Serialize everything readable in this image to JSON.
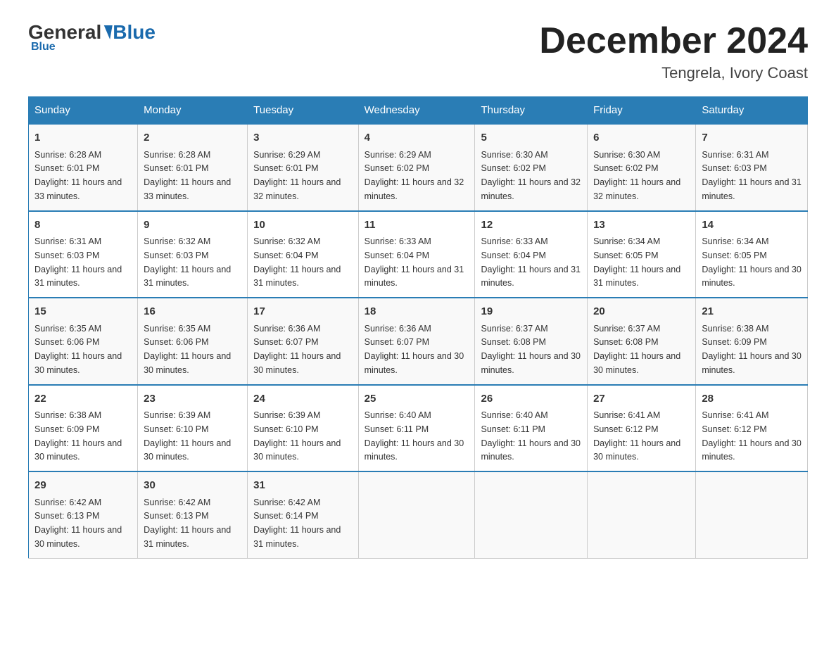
{
  "header": {
    "logo_general": "General",
    "logo_blue": "Blue",
    "month_title": "December 2024",
    "location": "Tengrela, Ivory Coast"
  },
  "days_of_week": [
    "Sunday",
    "Monday",
    "Tuesday",
    "Wednesday",
    "Thursday",
    "Friday",
    "Saturday"
  ],
  "weeks": [
    [
      {
        "day": "1",
        "sunrise": "6:28 AM",
        "sunset": "6:01 PM",
        "daylight": "11 hours and 33 minutes."
      },
      {
        "day": "2",
        "sunrise": "6:28 AM",
        "sunset": "6:01 PM",
        "daylight": "11 hours and 33 minutes."
      },
      {
        "day": "3",
        "sunrise": "6:29 AM",
        "sunset": "6:01 PM",
        "daylight": "11 hours and 32 minutes."
      },
      {
        "day": "4",
        "sunrise": "6:29 AM",
        "sunset": "6:02 PM",
        "daylight": "11 hours and 32 minutes."
      },
      {
        "day": "5",
        "sunrise": "6:30 AM",
        "sunset": "6:02 PM",
        "daylight": "11 hours and 32 minutes."
      },
      {
        "day": "6",
        "sunrise": "6:30 AM",
        "sunset": "6:02 PM",
        "daylight": "11 hours and 32 minutes."
      },
      {
        "day": "7",
        "sunrise": "6:31 AM",
        "sunset": "6:03 PM",
        "daylight": "11 hours and 31 minutes."
      }
    ],
    [
      {
        "day": "8",
        "sunrise": "6:31 AM",
        "sunset": "6:03 PM",
        "daylight": "11 hours and 31 minutes."
      },
      {
        "day": "9",
        "sunrise": "6:32 AM",
        "sunset": "6:03 PM",
        "daylight": "11 hours and 31 minutes."
      },
      {
        "day": "10",
        "sunrise": "6:32 AM",
        "sunset": "6:04 PM",
        "daylight": "11 hours and 31 minutes."
      },
      {
        "day": "11",
        "sunrise": "6:33 AM",
        "sunset": "6:04 PM",
        "daylight": "11 hours and 31 minutes."
      },
      {
        "day": "12",
        "sunrise": "6:33 AM",
        "sunset": "6:04 PM",
        "daylight": "11 hours and 31 minutes."
      },
      {
        "day": "13",
        "sunrise": "6:34 AM",
        "sunset": "6:05 PM",
        "daylight": "11 hours and 31 minutes."
      },
      {
        "day": "14",
        "sunrise": "6:34 AM",
        "sunset": "6:05 PM",
        "daylight": "11 hours and 30 minutes."
      }
    ],
    [
      {
        "day": "15",
        "sunrise": "6:35 AM",
        "sunset": "6:06 PM",
        "daylight": "11 hours and 30 minutes."
      },
      {
        "day": "16",
        "sunrise": "6:35 AM",
        "sunset": "6:06 PM",
        "daylight": "11 hours and 30 minutes."
      },
      {
        "day": "17",
        "sunrise": "6:36 AM",
        "sunset": "6:07 PM",
        "daylight": "11 hours and 30 minutes."
      },
      {
        "day": "18",
        "sunrise": "6:36 AM",
        "sunset": "6:07 PM",
        "daylight": "11 hours and 30 minutes."
      },
      {
        "day": "19",
        "sunrise": "6:37 AM",
        "sunset": "6:08 PM",
        "daylight": "11 hours and 30 minutes."
      },
      {
        "day": "20",
        "sunrise": "6:37 AM",
        "sunset": "6:08 PM",
        "daylight": "11 hours and 30 minutes."
      },
      {
        "day": "21",
        "sunrise": "6:38 AM",
        "sunset": "6:09 PM",
        "daylight": "11 hours and 30 minutes."
      }
    ],
    [
      {
        "day": "22",
        "sunrise": "6:38 AM",
        "sunset": "6:09 PM",
        "daylight": "11 hours and 30 minutes."
      },
      {
        "day": "23",
        "sunrise": "6:39 AM",
        "sunset": "6:10 PM",
        "daylight": "11 hours and 30 minutes."
      },
      {
        "day": "24",
        "sunrise": "6:39 AM",
        "sunset": "6:10 PM",
        "daylight": "11 hours and 30 minutes."
      },
      {
        "day": "25",
        "sunrise": "6:40 AM",
        "sunset": "6:11 PM",
        "daylight": "11 hours and 30 minutes."
      },
      {
        "day": "26",
        "sunrise": "6:40 AM",
        "sunset": "6:11 PM",
        "daylight": "11 hours and 30 minutes."
      },
      {
        "day": "27",
        "sunrise": "6:41 AM",
        "sunset": "6:12 PM",
        "daylight": "11 hours and 30 minutes."
      },
      {
        "day": "28",
        "sunrise": "6:41 AM",
        "sunset": "6:12 PM",
        "daylight": "11 hours and 30 minutes."
      }
    ],
    [
      {
        "day": "29",
        "sunrise": "6:42 AM",
        "sunset": "6:13 PM",
        "daylight": "11 hours and 30 minutes."
      },
      {
        "day": "30",
        "sunrise": "6:42 AM",
        "sunset": "6:13 PM",
        "daylight": "11 hours and 31 minutes."
      },
      {
        "day": "31",
        "sunrise": "6:42 AM",
        "sunset": "6:14 PM",
        "daylight": "11 hours and 31 minutes."
      },
      null,
      null,
      null,
      null
    ]
  ]
}
